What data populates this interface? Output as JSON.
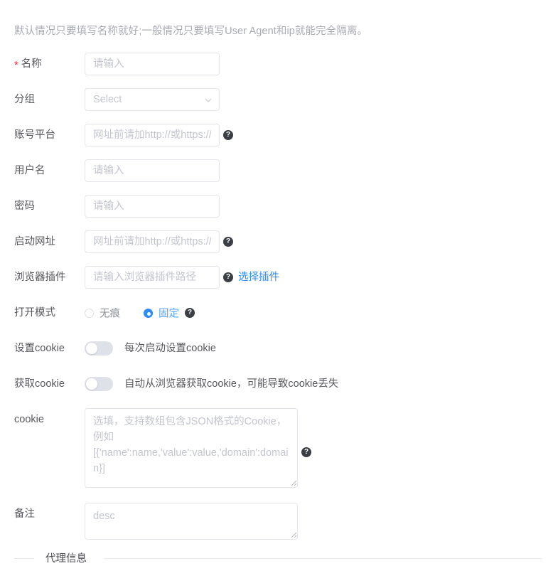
{
  "intro": {
    "text": "默认情况只要填写名称就好;一般情况只要填写User Agent和ip就能完全隔离。"
  },
  "help_icon_glyph": "?",
  "colors": {
    "accent": "#2e8bfa",
    "required": "#f5222d",
    "label": "#58595e",
    "placeholder": "#c4c6cf",
    "border": "#e4e6ec",
    "switch_off": "#dfe1e9",
    "help_bg": "#3b3e45",
    "divider": "#e8e8e8"
  },
  "form": {
    "name": {
      "label": "名称",
      "required_mark": "*",
      "placeholder": "请输入",
      "value": ""
    },
    "group": {
      "label": "分组",
      "selected": "Select",
      "chevron_icon": "chevron-down-icon"
    },
    "platform": {
      "label": "账号平台",
      "placeholder": "网址前请加http://或https://",
      "value": "",
      "has_help": true
    },
    "username": {
      "label": "用户名",
      "placeholder": "请输入",
      "value": ""
    },
    "password": {
      "label": "密码",
      "placeholder": "请输入",
      "value": ""
    },
    "start_url": {
      "label": "启动网址",
      "placeholder": "网址前请加http://或https://自",
      "value": "",
      "has_help": true
    },
    "browser_plugin": {
      "label": "浏览器插件",
      "placeholder": "请输入浏览器插件路径",
      "value": "",
      "has_help": true,
      "link_label": "选择插件"
    },
    "open_mode": {
      "label": "打开模式",
      "has_help": true,
      "options": [
        {
          "label": "无痕",
          "selected": false
        },
        {
          "label": "固定",
          "selected": true
        }
      ]
    },
    "set_cookie": {
      "label": "设置cookie",
      "enabled": false,
      "description": "每次启动设置cookie"
    },
    "get_cookie": {
      "label": "获取cookie",
      "enabled": false,
      "description": "自动从浏览器获取cookie，可能导致cookie丢失"
    },
    "cookie": {
      "label": "cookie",
      "placeholder": "选填，支持数组包含JSON格式的Cookie，例如[{'name':name,'value':value,'domain':domain}]",
      "value": "",
      "has_help": true
    },
    "remark": {
      "label": "备注",
      "placeholder": "desc",
      "value": ""
    }
  },
  "divider": {
    "title": "代理信息"
  }
}
